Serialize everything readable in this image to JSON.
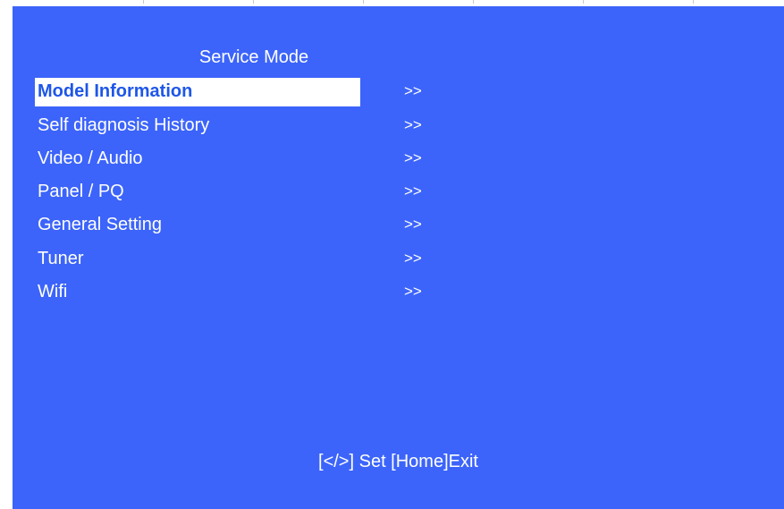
{
  "title": "Service Mode",
  "menu": {
    "items": [
      {
        "label": "Model Information",
        "arrow": ">>"
      },
      {
        "label": "Self diagnosis History",
        "arrow": ">>"
      },
      {
        "label": "Video / Audio",
        "arrow": ">>"
      },
      {
        "label": "Panel / PQ",
        "arrow": ">>"
      },
      {
        "label": "General Setting",
        "arrow": ">>"
      },
      {
        "label": "Tuner",
        "arrow": ">>"
      },
      {
        "label": "Wifi",
        "arrow": ">>"
      }
    ]
  },
  "footer": "[</>] Set [Home]Exit",
  "colors": {
    "background": "#3c64fa",
    "highlight": "#ffffff",
    "selected_text": "#1e56e8",
    "text": "#ffffff"
  }
}
